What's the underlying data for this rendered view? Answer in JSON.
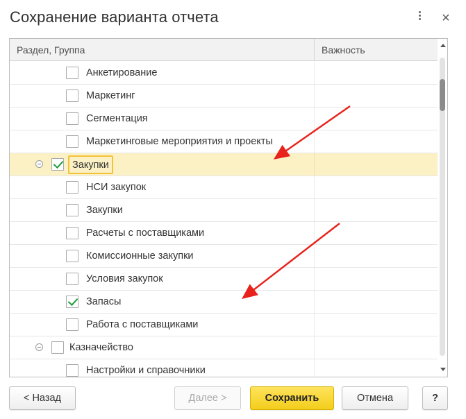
{
  "window": {
    "title": "Сохранение варианта отчета",
    "more_icon": "more-vertical-icon",
    "close_glyph": "×"
  },
  "table": {
    "columns": [
      "Раздел, Группа",
      "Важность"
    ],
    "rows": [
      {
        "label": "Анкетирование",
        "level": 2,
        "checked": false
      },
      {
        "label": "Маркетинг",
        "level": 2,
        "checked": false
      },
      {
        "label": "Сегментация",
        "level": 2,
        "checked": false
      },
      {
        "label": "Маркетинговые мероприятия и проекты",
        "level": 2,
        "checked": false
      },
      {
        "label": "Закупки",
        "level": 1,
        "checked": true,
        "expanded": true,
        "selected": true
      },
      {
        "label": "НСИ закупок",
        "level": 2,
        "checked": false
      },
      {
        "label": "Закупки",
        "level": 2,
        "checked": false
      },
      {
        "label": "Расчеты с поставщиками",
        "level": 2,
        "checked": false
      },
      {
        "label": "Комиссионные закупки",
        "level": 2,
        "checked": false
      },
      {
        "label": "Условия закупок",
        "level": 2,
        "checked": false
      },
      {
        "label": "Запасы",
        "level": 2,
        "checked": true
      },
      {
        "label": "Работа с поставщиками",
        "level": 2,
        "checked": false
      },
      {
        "label": "Казначейство",
        "level": 1,
        "checked": false,
        "expanded": true
      },
      {
        "label": "Настройки и справочники",
        "level": 2,
        "checked": false
      }
    ]
  },
  "buttons": {
    "back": "< Назад",
    "next": "Далее >",
    "save": "Сохранить",
    "cancel": "Отмена",
    "help": "?"
  },
  "colors": {
    "selected_row": "#fbf1c5",
    "focus_border": "#f4c23a",
    "check": "#1e9e3a",
    "primary_button": "#f3cd1c",
    "annotation_arrow": "#e8231c"
  }
}
